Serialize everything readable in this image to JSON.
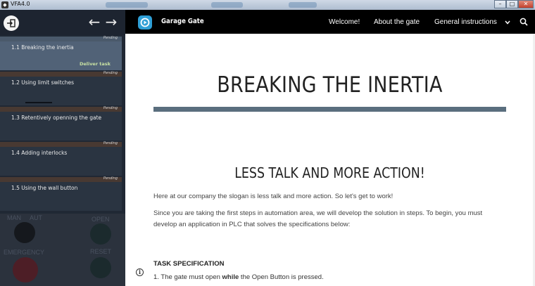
{
  "window": {
    "title": "VFA4.0",
    "minimize": "–",
    "maximize": "□",
    "close": "✕"
  },
  "sidebar": {
    "back_arrow": "←",
    "forward_arrow": "→",
    "tasks": [
      {
        "status": "Pending",
        "label": "1.1 Breaking the inertia",
        "action": "Deliver task"
      },
      {
        "status": "Pending",
        "label": "1.2 Using limit switches"
      },
      {
        "status": "Pending",
        "label": "1.3 Retentively openning the gate"
      },
      {
        "status": "Pending",
        "label": "1.4 Adding interlocks"
      },
      {
        "status": "Pending",
        "label": "1.5 Using the wall button"
      }
    ],
    "panel": {
      "man": "MAN",
      "aut": "AUT",
      "open": "OPEN",
      "emergency": "EMERGENCY",
      "reset": "RESET"
    }
  },
  "navbar": {
    "brand": "Garage Gate",
    "links": [
      "Welcome!",
      "About the gate",
      "General instructions"
    ]
  },
  "content": {
    "title": "BREAKING THE INERTIA",
    "subtitle": "LESS TALK AND MORE ACTION!",
    "para1": "Here at our company the slogan is less talk and more action. So let's get to work!",
    "para2": "Since you are taking the first steps in automation area, we will develop the solution in steps. To begin, you must develop an application in PLC that solves the specifications below:",
    "spec_title": "TASK SPECIFICATION",
    "spec_item_pre": "1. The gate must open ",
    "spec_item_bold": "while",
    "spec_item_post": " the Open Button is pressed."
  },
  "colors": {
    "navbar_bg": "#000000",
    "logo_accent": "#2f9fd6",
    "title_rule": "#5a6e7e",
    "active_task": "#53657a",
    "deliver_text": "#cfe8a8"
  }
}
